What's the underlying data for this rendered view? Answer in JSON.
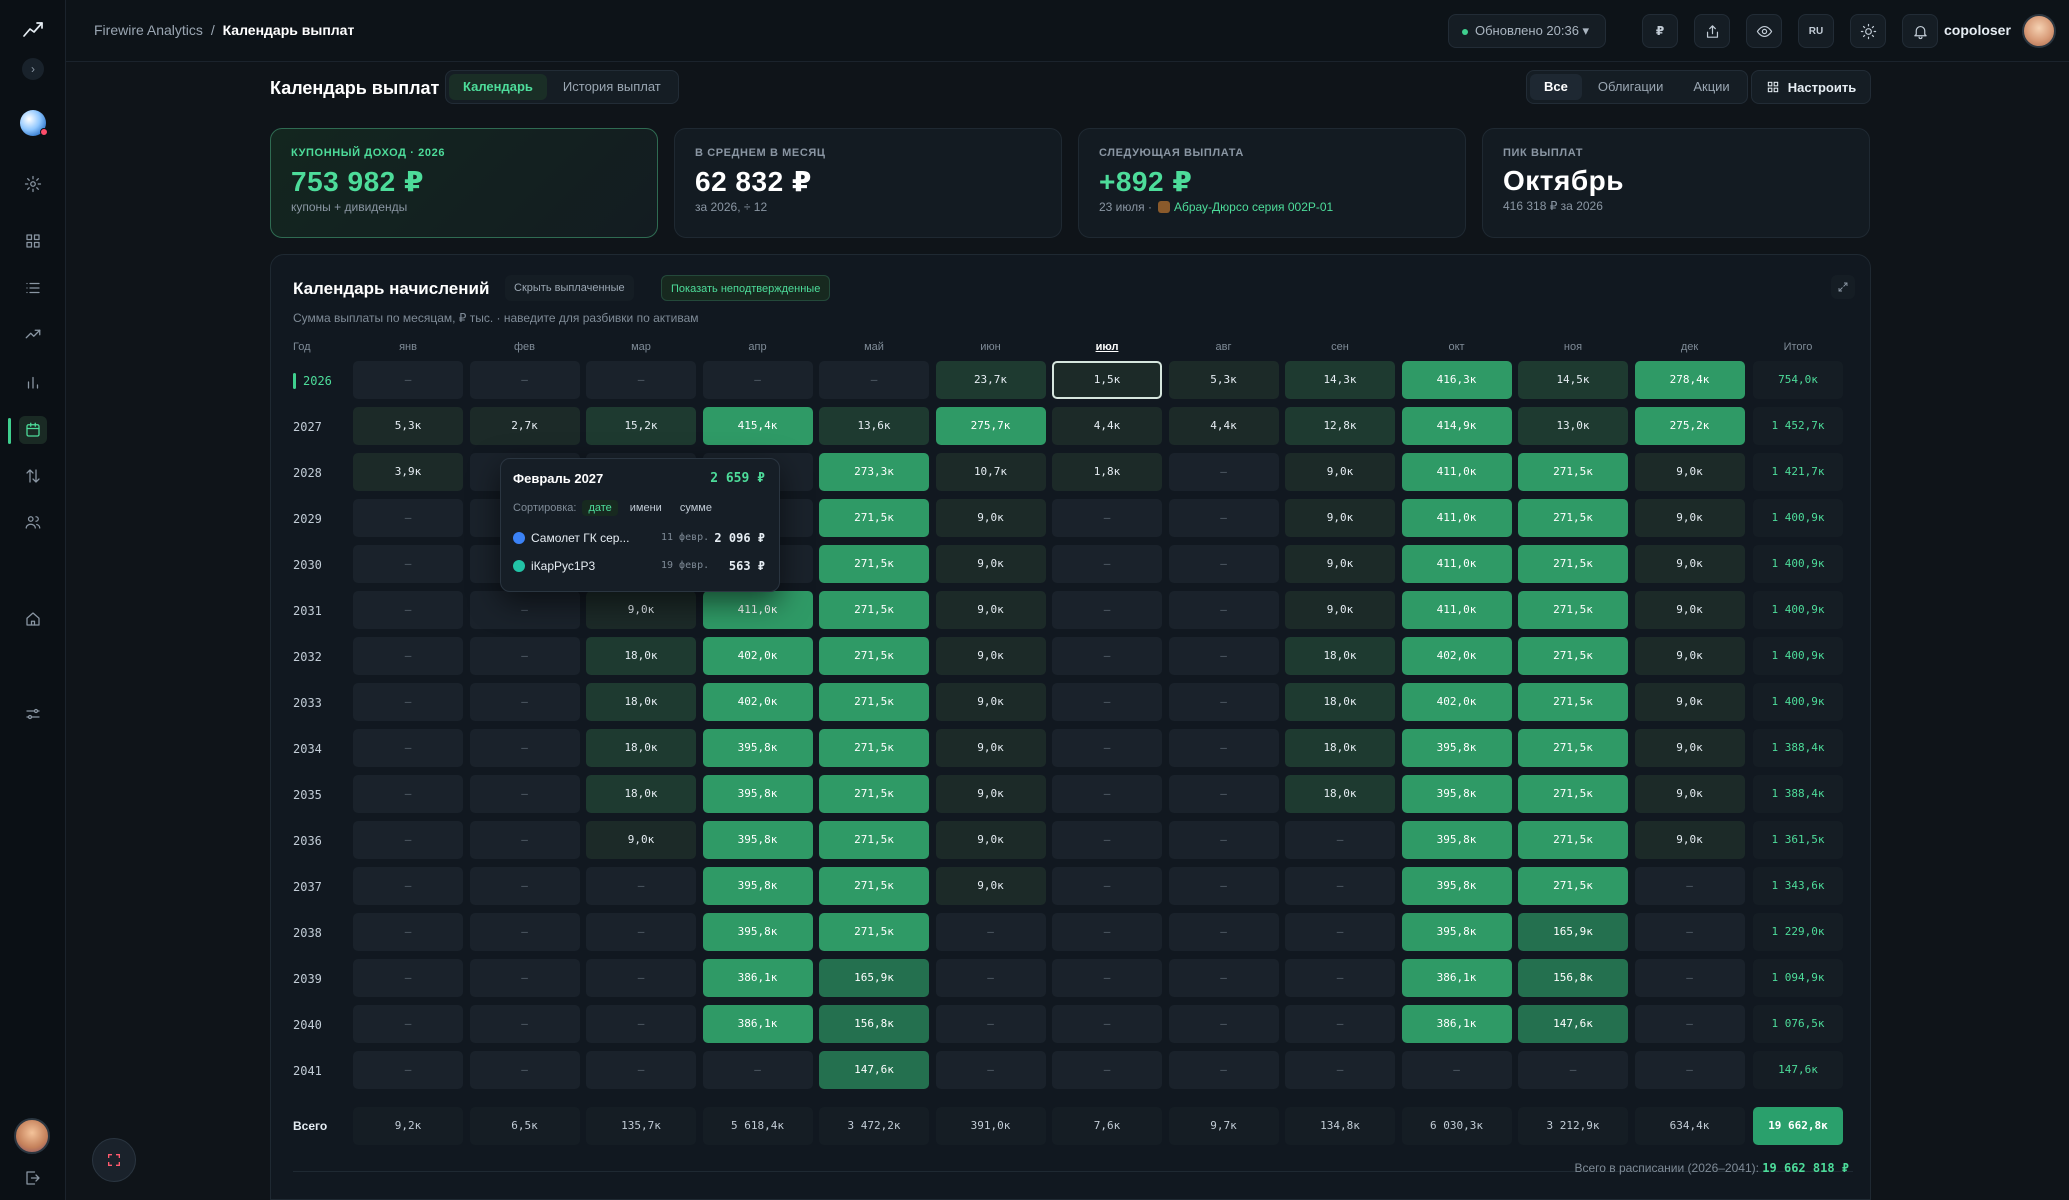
{
  "breadcrumb": {
    "root": "Firewire Analytics",
    "sep": "/",
    "current": "Календарь выплат"
  },
  "topbar": {
    "updated": "Обновлено 20:36 ▾",
    "currency": "₽",
    "lang": "RU",
    "username": "copoloser"
  },
  "page": {
    "title": "Календарь выплат",
    "view_tabs": [
      "Календарь",
      "История выплат"
    ],
    "filter_tabs": [
      "Все",
      "Облигации",
      "Акции"
    ],
    "configure": "Настроить"
  },
  "cards": [
    {
      "label": "Купонный доход · 2026",
      "value": "753 982 ₽",
      "sub": "купоны + дивиденды"
    },
    {
      "label": "В среднем в месяц",
      "value": "62 832 ₽",
      "sub": "за 2026, ÷ 12"
    },
    {
      "label": "Следующая выплата",
      "value": "+892 ₽",
      "sub_date": "23 июля ·",
      "sub_asset": "Абрау-Дюрсо серия 002Р-01"
    },
    {
      "label": "Пик выплат",
      "value": "Октябрь",
      "sub": "416 318 ₽ за 2026"
    }
  ],
  "calendar": {
    "title": "Календарь начислений",
    "chip_hide": "Скрыть выплаченные",
    "chip_show": "Показать неподтвержденные",
    "subtitle": "Сумма выплаты по месяцам, ₽ тыс. · наведите для разбивки по активам",
    "col_year": "Год",
    "months": [
      "янв",
      "фев",
      "мар",
      "апр",
      "май",
      "июн",
      "июл",
      "авг",
      "сен",
      "окт",
      "ноя",
      "дек"
    ],
    "col_total": "Итого",
    "rows": [
      {
        "year": "2026",
        "cells": [
          "–",
          "–",
          "–",
          "–",
          "–",
          "23,7к",
          "1,5к",
          "5,3к",
          "14,3к",
          "416,3к",
          "14,5к",
          "278,4к"
        ],
        "total": "754,0к"
      },
      {
        "year": "2027",
        "cells": [
          "5,3к",
          "2,7к",
          "15,2к",
          "415,4к",
          "13,6к",
          "275,7к",
          "4,4к",
          "4,4к",
          "12,8к",
          "414,9к",
          "13,0к",
          "275,2к"
        ],
        "total": "1 452,7к"
      },
      {
        "year": "2028",
        "cells": [
          "3,9к",
          "",
          "",
          "",
          "273,3к",
          "10,7к",
          "1,8к",
          "–",
          "9,0к",
          "411,0к",
          "271,5к",
          "9,0к"
        ],
        "total": "1 421,7к"
      },
      {
        "year": "2029",
        "cells": [
          "–",
          "",
          "",
          "",
          "271,5к",
          "9,0к",
          "–",
          "–",
          "9,0к",
          "411,0к",
          "271,5к",
          "9,0к"
        ],
        "total": "1 400,9к"
      },
      {
        "year": "2030",
        "cells": [
          "–",
          "",
          "",
          "",
          "271,5к",
          "9,0к",
          "–",
          "–",
          "9,0к",
          "411,0к",
          "271,5к",
          "9,0к"
        ],
        "total": "1 400,9к"
      },
      {
        "year": "2031",
        "cells": [
          "–",
          "–",
          "9,0к",
          "411,0к",
          "271,5к",
          "9,0к",
          "–",
          "–",
          "9,0к",
          "411,0к",
          "271,5к",
          "9,0к"
        ],
        "total": "1 400,9к"
      },
      {
        "year": "2032",
        "cells": [
          "–",
          "–",
          "18,0к",
          "402,0к",
          "271,5к",
          "9,0к",
          "–",
          "–",
          "18,0к",
          "402,0к",
          "271,5к",
          "9,0к"
        ],
        "total": "1 400,9к"
      },
      {
        "year": "2033",
        "cells": [
          "–",
          "–",
          "18,0к",
          "402,0к",
          "271,5к",
          "9,0к",
          "–",
          "–",
          "18,0к",
          "402,0к",
          "271,5к",
          "9,0к"
        ],
        "total": "1 400,9к"
      },
      {
        "year": "2034",
        "cells": [
          "–",
          "–",
          "18,0к",
          "395,8к",
          "271,5к",
          "9,0к",
          "–",
          "–",
          "18,0к",
          "395,8к",
          "271,5к",
          "9,0к"
        ],
        "total": "1 388,4к"
      },
      {
        "year": "2035",
        "cells": [
          "–",
          "–",
          "18,0к",
          "395,8к",
          "271,5к",
          "9,0к",
          "–",
          "–",
          "18,0к",
          "395,8к",
          "271,5к",
          "9,0к"
        ],
        "total": "1 388,4к"
      },
      {
        "year": "2036",
        "cells": [
          "–",
          "–",
          "9,0к",
          "395,8к",
          "271,5к",
          "9,0к",
          "–",
          "–",
          "–",
          "395,8к",
          "271,5к",
          "9,0к"
        ],
        "total": "1 361,5к"
      },
      {
        "year": "2037",
        "cells": [
          "–",
          "–",
          "–",
          "395,8к",
          "271,5к",
          "9,0к",
          "–",
          "–",
          "–",
          "395,8к",
          "271,5к",
          "–"
        ],
        "total": "1 343,6к"
      },
      {
        "year": "2038",
        "cells": [
          "–",
          "–",
          "–",
          "395,8к",
          "271,5к",
          "–",
          "–",
          "–",
          "–",
          "395,8к",
          "165,9к",
          "–"
        ],
        "total": "1 229,0к"
      },
      {
        "year": "2039",
        "cells": [
          "–",
          "–",
          "–",
          "386,1к",
          "165,9к",
          "–",
          "–",
          "–",
          "–",
          "386,1к",
          "156,8к",
          "–"
        ],
        "total": "1 094,9к"
      },
      {
        "year": "2040",
        "cells": [
          "–",
          "–",
          "–",
          "386,1к",
          "156,8к",
          "–",
          "–",
          "–",
          "–",
          "386,1к",
          "147,6к",
          "–"
        ],
        "total": "1 076,5к"
      },
      {
        "year": "2041",
        "cells": [
          "–",
          "–",
          "–",
          "–",
          "147,6к",
          "–",
          "–",
          "–",
          "–",
          "–",
          "–",
          "–"
        ],
        "total": "147,6к"
      }
    ],
    "summary": {
      "label": "Всего",
      "cells": [
        "9,2к",
        "6,5к",
        "135,7к",
        "5 618,4к",
        "3 472,2к",
        "391,0к",
        "7,6к",
        "9,7к",
        "134,8к",
        "6 030,3к",
        "3 212,9к",
        "634,4к"
      ],
      "total": "19 662,8к"
    },
    "footer_label": "Всего в расписании (2026–2041):",
    "footer_value": "19 662 818 ₽"
  },
  "tooltip": {
    "title": "Февраль 2027",
    "total": "2 659 ₽",
    "sort_label": "Сортировка:",
    "sort_options": [
      "дате",
      "имени",
      "сумме"
    ],
    "items": [
      {
        "name": "Самолет ГК сер...",
        "date": "11 февр.",
        "amount": "2 096 ₽",
        "color": "#3b82f6"
      },
      {
        "name": "iКарРус1Р3",
        "date": "19 февр.",
        "amount": "563 ₽",
        "color": "#22c3a6"
      }
    ]
  },
  "colors": {
    "accent": "#3fcf8e",
    "bg": "#0f1419",
    "cell": "#1a222b"
  }
}
